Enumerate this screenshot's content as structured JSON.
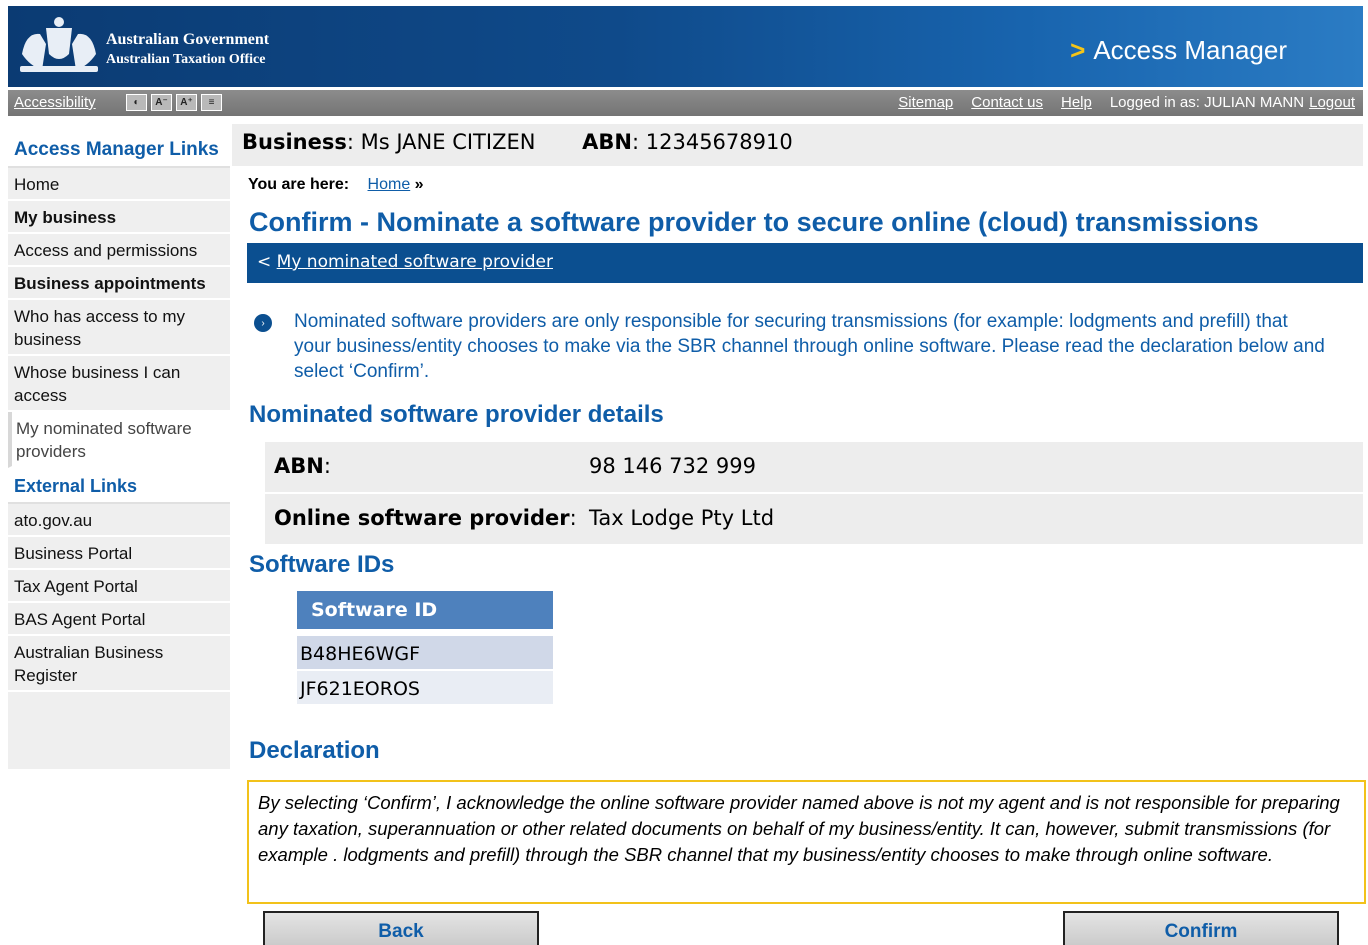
{
  "header": {
    "gov_line1": "Australian Government",
    "gov_line2": "Australian Taxation Office",
    "chevron": ">",
    "app_title": "Access Manager"
  },
  "utility": {
    "accessibility": "Accessibility",
    "icons": [
      "contrast-icon",
      "text-smaller-icon",
      "text-larger-icon",
      "text-only-icon"
    ],
    "sitemap": "Sitemap",
    "contact": "Contact us",
    "help": "Help",
    "logged_in": "Logged in as: JULIAN MANN",
    "logout": "Logout"
  },
  "sidebar": {
    "heading": "Access Manager Links",
    "items": [
      {
        "label": "Home"
      },
      {
        "label": "My business"
      },
      {
        "label": "Access and permissions"
      },
      {
        "label": "Business appointments"
      },
      {
        "label": "Who has access to my business"
      },
      {
        "label": "Whose business I can access"
      },
      {
        "label": "My nominated software providers"
      }
    ],
    "external_heading": "External Links",
    "external": [
      {
        "label": "ato.gov.au"
      },
      {
        "label": "Business Portal"
      },
      {
        "label": "Tax Agent Portal"
      },
      {
        "label": "BAS Agent Portal"
      },
      {
        "label": "Australian Business Register"
      }
    ]
  },
  "business": {
    "business_label": "Business",
    "business_name": "Ms JANE CITIZEN",
    "abn_label": "ABN",
    "abn_value": "12345678910"
  },
  "breadcrumb": {
    "label": "You are here:",
    "home": "Home",
    "sep": "»"
  },
  "page": {
    "title": "Confirm - Nominate a software provider to secure online (cloud) transmissions",
    "back_link": "My nominated software provider",
    "info": "Nominated  software providers are only responsible  for securing transmissions  (for example:  lodgments  and prefill) that your business/entity  chooses  to make via the SBR channel through online software. Please read the declaration below and select ‘Confirm’.",
    "details_heading": "Nominated software provider details",
    "abn_label": "ABN",
    "abn_value": "98 146 732 999",
    "provider_label": "Online software provider",
    "provider_value": "Tax Lodge Pty Ltd",
    "software_heading": "Software IDs",
    "software_col": "Software ID",
    "software_ids": [
      "B48HE6WGF",
      "JF621EOROS"
    ],
    "declaration_heading": "Declaration",
    "declaration": "By selecting ‘Confirm’, I acknowledge the online software provider named above is not my agent and is not responsible for preparing any taxation, superannuation or other related documents on behalf of my business/entity. It can, however, submit transmissions (for example . lodgments and prefill) through the SBR channel that my business/entity chooses to make through online software.",
    "back_button": "Back",
    "confirm_button": "Confirm"
  }
}
